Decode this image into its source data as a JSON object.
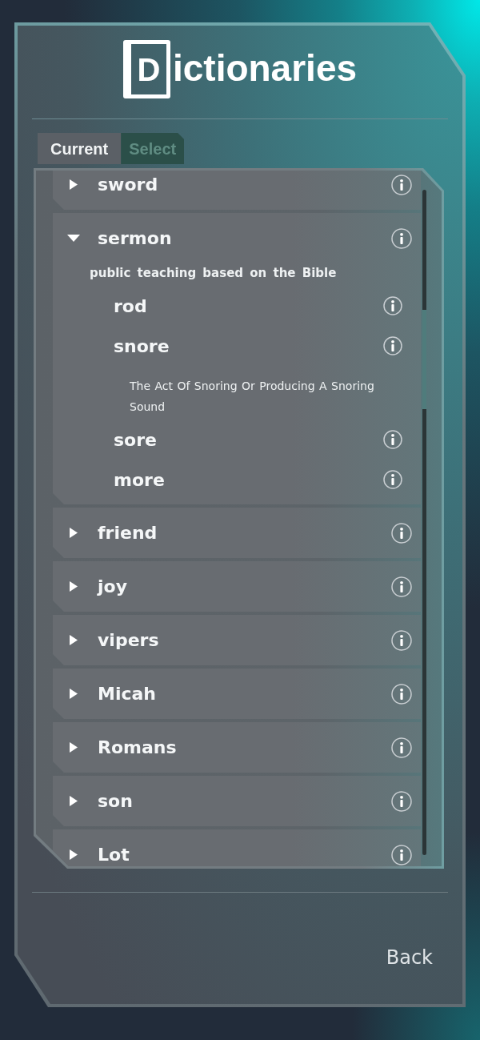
{
  "title": {
    "initial": "D",
    "text": "ictionaries"
  },
  "tabs": [
    {
      "label": "Current",
      "selected": true
    },
    {
      "label": "Select",
      "selected": false
    }
  ],
  "entries": [
    {
      "word": "sword",
      "expanded": false
    },
    {
      "word": "sermon",
      "expanded": true,
      "definition": "public teaching based on the Bible",
      "children": [
        {
          "word": "rod"
        },
        {
          "word": "snore",
          "definition": "The Act Of Snoring Or Producing A Snoring Sound"
        },
        {
          "word": "sore"
        },
        {
          "word": "more"
        }
      ]
    },
    {
      "word": "friend",
      "expanded": false
    },
    {
      "word": "joy",
      "expanded": false
    },
    {
      "word": "vipers",
      "expanded": false
    },
    {
      "word": "Micah",
      "expanded": false
    },
    {
      "word": "Romans",
      "expanded": false
    },
    {
      "word": "son",
      "expanded": false
    },
    {
      "word": "Lot",
      "expanded": false
    }
  ],
  "back_button": {
    "label": "Back"
  }
}
